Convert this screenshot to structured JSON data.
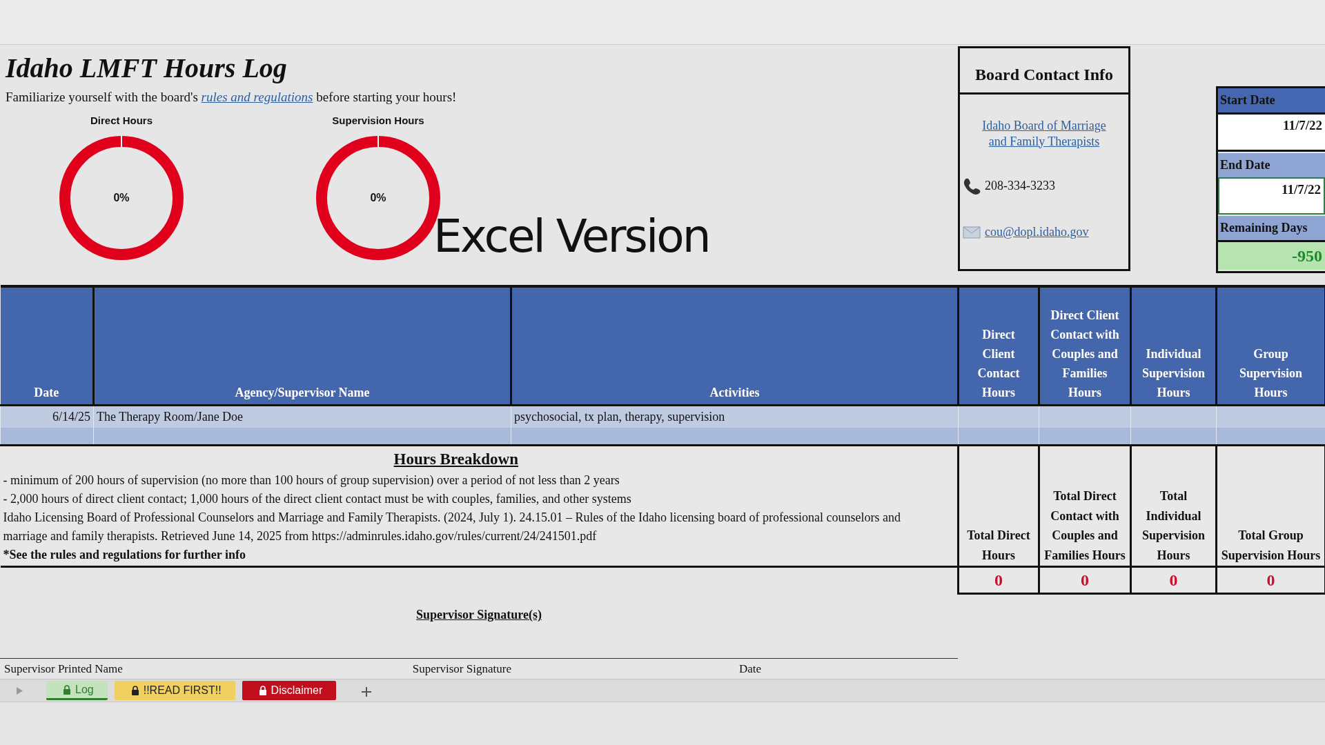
{
  "title": "Idaho LMFT Hours Log",
  "intro": {
    "before": "Familiarize yourself with the board's",
    "link": "rules and regulations",
    "after": "before starting your hours!"
  },
  "gauges": [
    {
      "title": "Direct Hours",
      "reading": "0%"
    },
    {
      "title": "Supervision Hours",
      "reading": "0%"
    }
  ],
  "overlay_caption": "Excel Version",
  "board_contact": {
    "title": "Board Contact Info",
    "link": "Idaho Board of Marriage and Family Therapists",
    "phone": "208-334-3233",
    "email": "cou@dopl.idaho.gov"
  },
  "dates": [
    {
      "label": "Start Date",
      "color": "#4566b0",
      "value": "11/7/22",
      "kind": "date",
      "selected": false
    },
    {
      "label": "End Date",
      "color": "#8ea4d3",
      "value": "11/7/22",
      "kind": "date",
      "selected": true
    },
    {
      "label": "Remaining Days",
      "color": "#8ea4d3",
      "value": "-950",
      "kind": "result",
      "selected": false
    }
  ],
  "log_table": {
    "columns": [
      "Date",
      "Agency/Supervisor Name",
      "Activities",
      "Direct Client Contact Hours",
      "Direct Client Contact with Couples and Families Hours",
      "Individual Supervision Hours",
      "Group Supervision Hours"
    ],
    "rows": [
      {
        "date": "6/14/25",
        "agency": "The Therapy Room/Jane Doe",
        "activities": "psychosocial, tx plan, therapy, supervision"
      }
    ]
  },
  "hours_breakdown": {
    "title": "Hours Breakdown",
    "lines": [
      "- minimum of 200 hours of supervision (no more than 100 hours of group supervision) over a period of not less than 2 years",
      "- 2,000 hours of direct client contact; 1,000 hours of the direct client contact must be with couples, families, and other systems",
      "Idaho Licensing Board of Professional Counselors and Marriage and Family Therapists. (2024, July 1). 24.15.01 – Rules of the Idaho licensing board of professional counselors and marriage and family therapists. Retrieved June 14, 2025 from https://adminrules.idaho.gov/rules/current/24/241501.pdf"
    ],
    "note": "*See the rules and regulations for further info"
  },
  "totals": [
    {
      "label": "Total Direct Hours",
      "value": "0"
    },
    {
      "label": "Total Direct Contact with Couples and Families Hours",
      "value": "0"
    },
    {
      "label": "Total Individual Supervision Hours",
      "value": "0"
    },
    {
      "label": "Total Group Supervision Hours",
      "value": "0"
    }
  ],
  "signature": {
    "title": "Supervisor Signature(s)",
    "fields": [
      "Supervisor Printed Name",
      "Supervisor Signature",
      "Date"
    ]
  },
  "sheet_tabs": [
    {
      "label": "Log",
      "locked": true,
      "selected": true,
      "color": "#c4e3bd"
    },
    {
      "label": "!!READ FIRST!!",
      "locked": true,
      "selected": false,
      "color": "#f0d060"
    },
    {
      "label": "Disclaimer",
      "locked": true,
      "selected": false,
      "color": "#c00f1d"
    }
  ]
}
